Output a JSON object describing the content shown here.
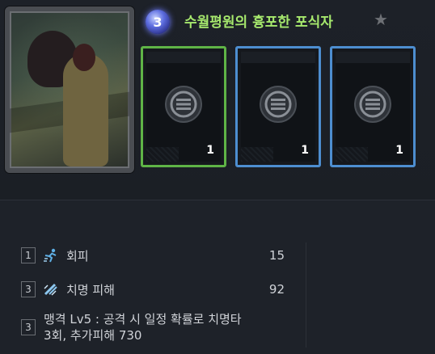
{
  "header": {
    "grade": "3",
    "title": "수월평원의 흉포한 포식자"
  },
  "slots": [
    {
      "count": "1",
      "border_color": "#5fb446"
    },
    {
      "count": "1",
      "border_color": "#4d8ed0"
    },
    {
      "count": "1",
      "border_color": "#4d8ed0"
    }
  ],
  "stats": [
    {
      "level": "1",
      "icon": "evasion-icon",
      "name": "회피",
      "value": "15"
    },
    {
      "level": "3",
      "icon": "critical-damage-icon",
      "name": "치명 피해",
      "value": "92"
    }
  ],
  "effect": {
    "level": "3",
    "text_line1": "맹격 Lv5 : 공격 시 일정 확률로 치명타",
    "text_line2": "3회, 추가피해 730"
  }
}
